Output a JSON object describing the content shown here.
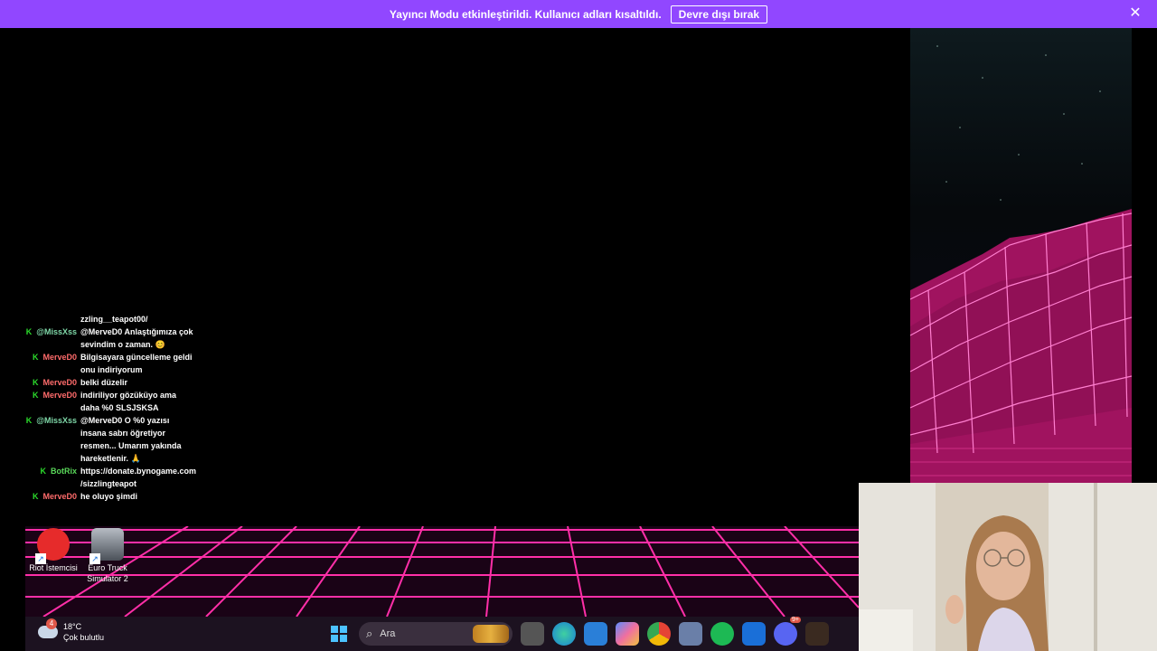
{
  "banner": {
    "message": "Yayıncı Modu etkinleştirildi. Kullanıcı adları kısaltıldı.",
    "button_label": "Devre dışı bırak",
    "close_glyph": "✕",
    "color": "#9147ff"
  },
  "chat": {
    "badge_glyph": "K",
    "partial_top": "zzling__teapot00/",
    "messages": [
      {
        "user": "@MissXss",
        "user_color": "#7fd8a8",
        "text": "@MerveD0 Anlaştığımıza çok sevindim o zaman. 😊"
      },
      {
        "user": "MerveD0",
        "user_color": "#ff6b6b",
        "text": "Bilgisayara güncelleme geldi onu indiriyorum"
      },
      {
        "user": "MerveD0",
        "user_color": "#ff6b6b",
        "text": "belki düzelir"
      },
      {
        "user": "MerveD0",
        "user_color": "#ff6b6b",
        "text": "indiriliyor gözüküyo ama daha %0 SLSJSKSA"
      },
      {
        "user": "@MissXss",
        "user_color": "#7fd8a8",
        "text": "@MerveD0 O %0 yazısı insana sabrı öğretiyor resmen... Umarım yakında hareketlenir. 🙏"
      },
      {
        "user": "BotRix",
        "user_color": "#5ad85a",
        "text": "https://donate.bynogame.com /sizzlingteapot"
      },
      {
        "user": "MerveD0",
        "user_color": "#ff6b6b",
        "text": "he oluyo şimdi"
      }
    ]
  },
  "desktop": {
    "icons": [
      {
        "label": "Riot İstemcisi",
        "icon": "riot-client-icon"
      },
      {
        "label": "Euro Truck Simulator 2",
        "icon": "truck-icon"
      }
    ]
  },
  "taskbar": {
    "weather_badge": "4",
    "temperature": "18°C",
    "condition": "Çok bulutlu",
    "search_placeholder": "Ara",
    "apps": [
      "start-icon",
      "search-icon",
      "task-view-icon",
      "edge-icon",
      "store-icon",
      "copilot-icon",
      "chrome-icon",
      "app-icon",
      "spotify-icon",
      "camera-app-icon",
      "discord-icon",
      "game-icon"
    ],
    "discord_badge": "9+"
  }
}
